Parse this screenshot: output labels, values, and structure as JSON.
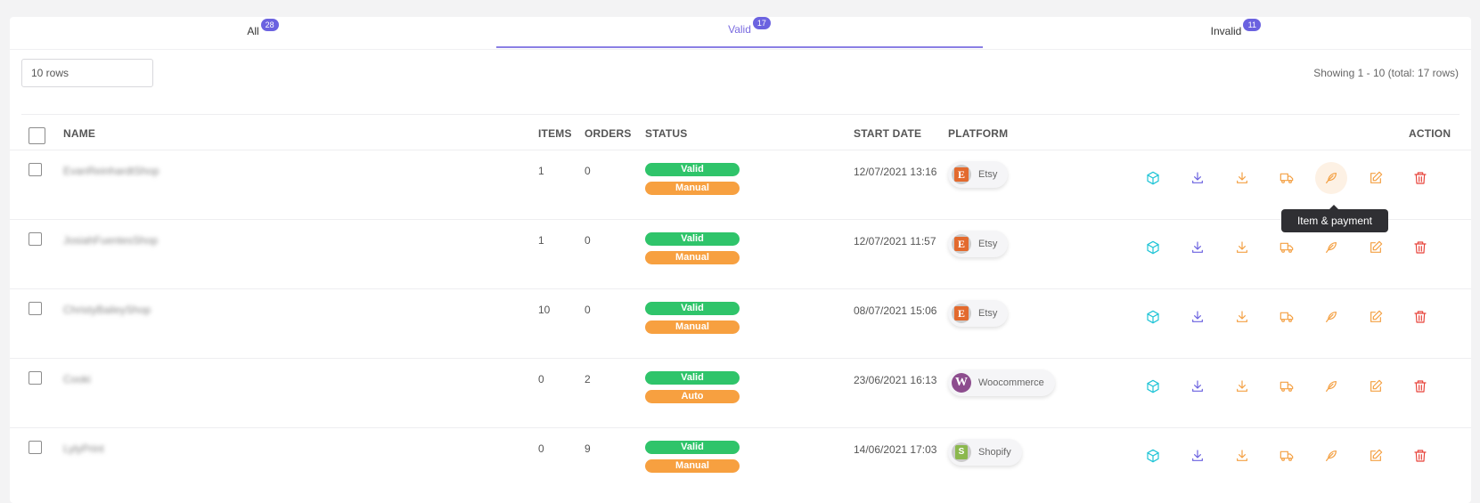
{
  "tabs": [
    {
      "label": "All",
      "count": "28"
    },
    {
      "label": "Valid",
      "count": "17"
    },
    {
      "label": "Invalid",
      "count": "11"
    }
  ],
  "rows_select": "10 rows",
  "showing": "Showing 1 - 10 (total: 17 rows)",
  "columns": {
    "name": "NAME",
    "items": "ITEMS",
    "orders": "ORDERS",
    "status": "STATUS",
    "start_date": "START DATE",
    "platform": "PLATFORM",
    "action": "ACTION"
  },
  "rows": [
    {
      "name": "EvanReinhardtShop",
      "items": "1",
      "orders": "0",
      "status": "Valid",
      "mode": "Manual",
      "date": "12/07/2021 13:16",
      "platform": "Etsy"
    },
    {
      "name": "JosiahFuentesShop",
      "items": "1",
      "orders": "0",
      "status": "Valid",
      "mode": "Manual",
      "date": "12/07/2021 11:57",
      "platform": "Etsy"
    },
    {
      "name": "ChristyBaileyShop",
      "items": "10",
      "orders": "0",
      "status": "Valid",
      "mode": "Manual",
      "date": "08/07/2021 15:06",
      "platform": "Etsy"
    },
    {
      "name": "Cooki",
      "items": "0",
      "orders": "2",
      "status": "Valid",
      "mode": "Auto",
      "date": "23/06/2021 16:13",
      "platform": "Woocommerce"
    },
    {
      "name": "LylyPrint",
      "items": "0",
      "orders": "9",
      "status": "Valid",
      "mode": "Manual",
      "date": "14/06/2021 17:03",
      "platform": "Shopify"
    }
  ],
  "actions": [
    "cube-icon",
    "download-icon",
    "download-alt-icon",
    "truck-icon",
    "feather-icon",
    "edit-icon",
    "trash-icon"
  ],
  "tooltip": "Item & payment",
  "colors": {
    "accent": "#6b62e0",
    "valid": "#2fc46a",
    "manual": "#f7a040",
    "cube": "#1ec4d6",
    "download": "#6b62e0",
    "orange": "#f4a043",
    "trash": "#e8453c"
  }
}
